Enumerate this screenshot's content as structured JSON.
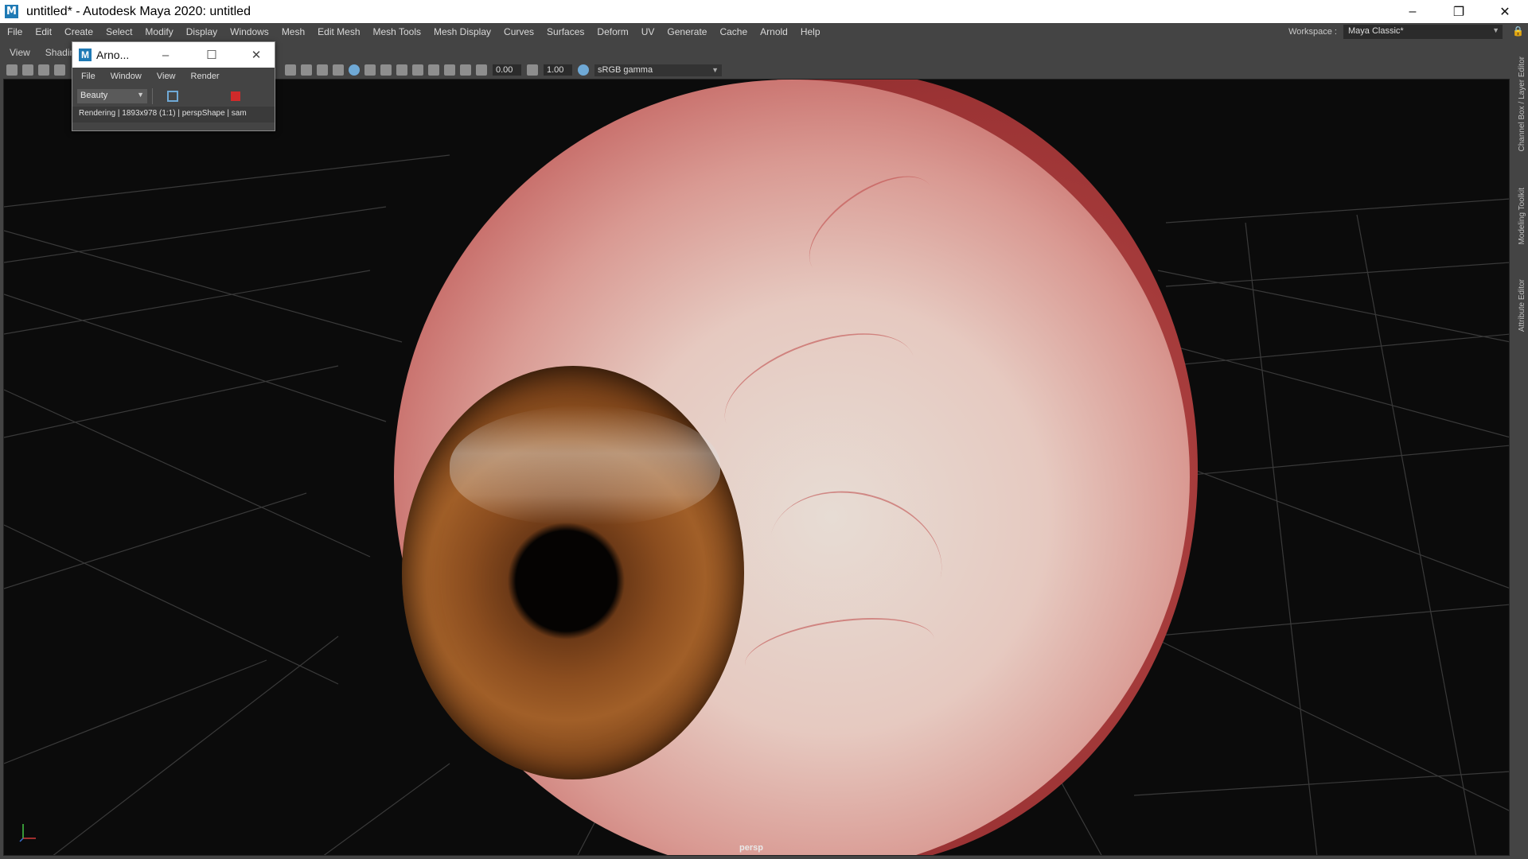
{
  "window": {
    "title": "untitled* - Autodesk Maya 2020: untitled",
    "logo": "M",
    "minimize_icon": "–",
    "restore_icon": "❐",
    "close_icon": "✕"
  },
  "menubar": {
    "items": [
      "File",
      "Edit",
      "Create",
      "Select",
      "Modify",
      "Display",
      "Windows",
      "Mesh",
      "Edit Mesh",
      "Mesh Tools",
      "Mesh Display",
      "Curves",
      "Surfaces",
      "Deform",
      "UV",
      "Generate",
      "Cache",
      "Arnold",
      "Help"
    ],
    "workspace_label": "Workspace :",
    "workspace_value": "Maya Classic*"
  },
  "panel": {
    "menu": [
      "View",
      "Shadin"
    ],
    "field_a": "0.00",
    "field_b": "1.00",
    "colorspace": "sRGB gamma"
  },
  "viewport": {
    "camera_label": "persp"
  },
  "sidetabs": [
    "Channel Box / Layer Editor",
    "Modeling Toolkit",
    "Attribute Editor"
  ],
  "arnold": {
    "title": "Arno...",
    "logo": "M",
    "menu": [
      "File",
      "Window",
      "View",
      "Render"
    ],
    "aov": "Beauty",
    "status": "Rendering | 1893x978 (1:1) | perspShape | sam"
  }
}
